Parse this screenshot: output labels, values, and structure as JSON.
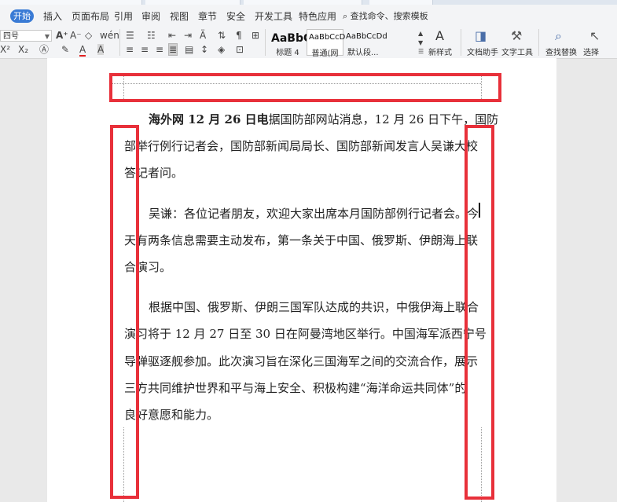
{
  "menu": {
    "start": "开始",
    "items": [
      "插入",
      "页面布局",
      "引用",
      "审阅",
      "视图",
      "章节",
      "安全",
      "开发工具",
      "特色应用"
    ],
    "search": "查找命令、搜索模板"
  },
  "ribbon": {
    "font_size": "四号",
    "styles": [
      {
        "sample": "AaBbC",
        "label": "标题 4"
      },
      {
        "sample": "AaBbCcD",
        "label": "普通(网站)"
      },
      {
        "sample": "AaBbCcDd",
        "label": "默认段..."
      }
    ],
    "new_style": "新样式",
    "doc_helper": "文档助手",
    "text_tools": "文字工具",
    "find_replace": "查找替换",
    "select": "选择"
  },
  "document": {
    "para1_bold": "海外网 12 月 26 日电",
    "para1_line1": "据国防部网站消息，12 月 26 日下午，国防",
    "para1_line2": "部举行例行记者会，国防部新闻局局长、国防部新闻发言人吴谦大校",
    "para1_line3": "答记者问。",
    "para2_line1": "吴谦：各位记者朋友，欢迎大家出席本月国防部例行记者会。今",
    "para2_line2": "天有两条信息需要主动发布，第一条关于中国、俄罗斯、伊朗海上联",
    "para2_line3": "合演习。",
    "para3_line1": "根据中国、俄罗斯、伊朗三国军队达成的共识，中俄伊海上联合",
    "para3_line2": "演习将于 12 月 27 日至 30 日在阿曼湾地区举行。中国海军派西宁号",
    "para3_line3": "导弹驱逐舰参加。此次演习旨在深化三国海军之间的交流合作，展示",
    "para3_line4": "三方共同维护世界和平与海上安全、积极构建“海洋命运共同体”的",
    "para3_line5": "良好意愿和能力。"
  },
  "colors": {
    "highlight": "#e8303a",
    "accent": "#3a7bd5"
  }
}
